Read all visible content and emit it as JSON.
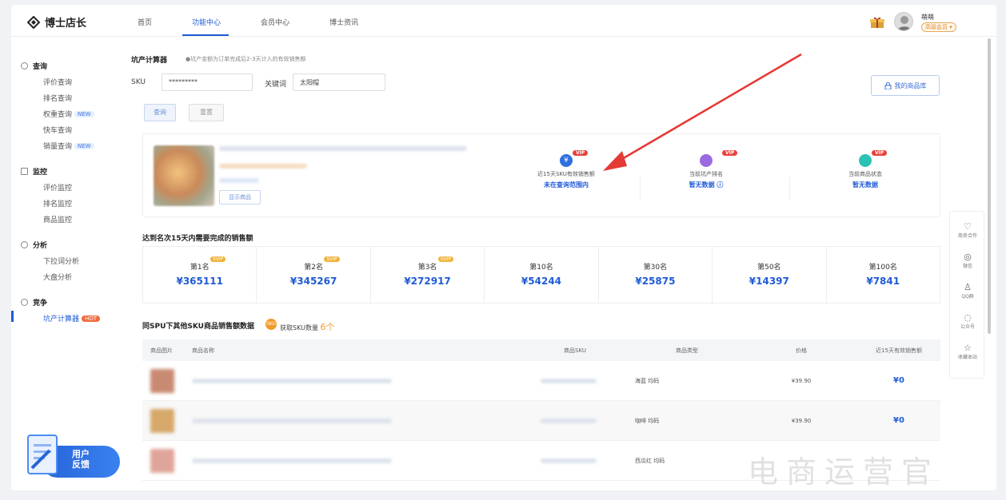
{
  "nav": {
    "logo_text": "博士店长",
    "items": [
      "首页",
      "功能中心",
      "会员中心",
      "博士资讯"
    ],
    "user_name": "萌萌",
    "user_badge": "高级会员 ▾"
  },
  "sidebar": {
    "sections": [
      {
        "title": "查询",
        "items": [
          {
            "label": "评价查询",
            "tag": ""
          },
          {
            "label": "排名查询",
            "tag": ""
          },
          {
            "label": "权重查询",
            "tag": "NEW"
          },
          {
            "label": "快车查询",
            "tag": ""
          },
          {
            "label": "销量查询",
            "tag": "NEW"
          }
        ]
      },
      {
        "title": "监控",
        "items": [
          {
            "label": "评价监控",
            "tag": ""
          },
          {
            "label": "排名监控",
            "tag": ""
          },
          {
            "label": "商品监控",
            "tag": ""
          }
        ]
      },
      {
        "title": "分析",
        "items": [
          {
            "label": "下拉词分析",
            "tag": ""
          },
          {
            "label": "大盘分析",
            "tag": ""
          }
        ]
      },
      {
        "title": "竞争",
        "items": [
          {
            "label": "坑产计算器",
            "tag": "HOT"
          }
        ]
      }
    ],
    "feedback": "用户反馈",
    "feedback_line1": "用户",
    "feedback_line2": "反馈"
  },
  "calculator": {
    "title": "坑产计算器",
    "note": "●坑产金额为订单完成后2-3天计入的有效销售额",
    "sku_label": "SKU",
    "sku_value": "*********",
    "keyword_label": "关键词",
    "keyword_value": "太阳帽",
    "query_button": "查询",
    "reset_button": "重置",
    "library_button": "我的商品库"
  },
  "product": {
    "show_button": "显示商品",
    "metrics": [
      {
        "vip": "VIP",
        "label": "近15天SKU有效销售额",
        "value": "未在查询范围内"
      },
      {
        "vip": "VIP",
        "label": "当前坑产排名",
        "value": "暂无数据 ⓘ"
      },
      {
        "vip": "VIP",
        "label": "当前商品状态",
        "value": "暂无数据"
      }
    ]
  },
  "ranks": {
    "title": "达到名次15天内需要完成的销售额",
    "items": [
      {
        "name": "第1名",
        "value": "¥365111",
        "svip": "SVIP"
      },
      {
        "name": "第2名",
        "value": "¥345267",
        "svip": "SVIP"
      },
      {
        "name": "第3名",
        "value": "¥272917",
        "svip": "SVIP"
      },
      {
        "name": "第10名",
        "value": "¥54244",
        "svip": ""
      },
      {
        "name": "第30名",
        "value": "¥25875",
        "svip": ""
      },
      {
        "name": "第50名",
        "value": "¥14397",
        "svip": ""
      },
      {
        "name": "第100名",
        "value": "¥7841",
        "svip": ""
      }
    ]
  },
  "spu": {
    "title": "同SPU下其他SKU商品销售额数据",
    "sku_badge": "SKU",
    "sku_text": "获取SKU数量",
    "sku_count": "6个",
    "columns": [
      "商品图片",
      "商品名称",
      "商品SKU",
      "商品类型",
      "价格",
      "近15天有效销售额"
    ],
    "rows": [
      {
        "type": "海蓝 均码",
        "price": "¥39.90",
        "sales": "¥0"
      },
      {
        "type": "咖啡 均码",
        "price": "¥39.90",
        "sales": "¥0"
      },
      {
        "type": "西瓜红 均码",
        "price": "",
        "sales": ""
      }
    ]
  },
  "rightbar": [
    "商务合作",
    "微信",
    "QQ群",
    "公众号",
    "收藏本站"
  ],
  "watermark": "电商运营官",
  "colors": {
    "accent": "#1f5bd6",
    "hot": "#f06a3c",
    "vip": "#e8403a",
    "svip": "#f0b33a"
  }
}
